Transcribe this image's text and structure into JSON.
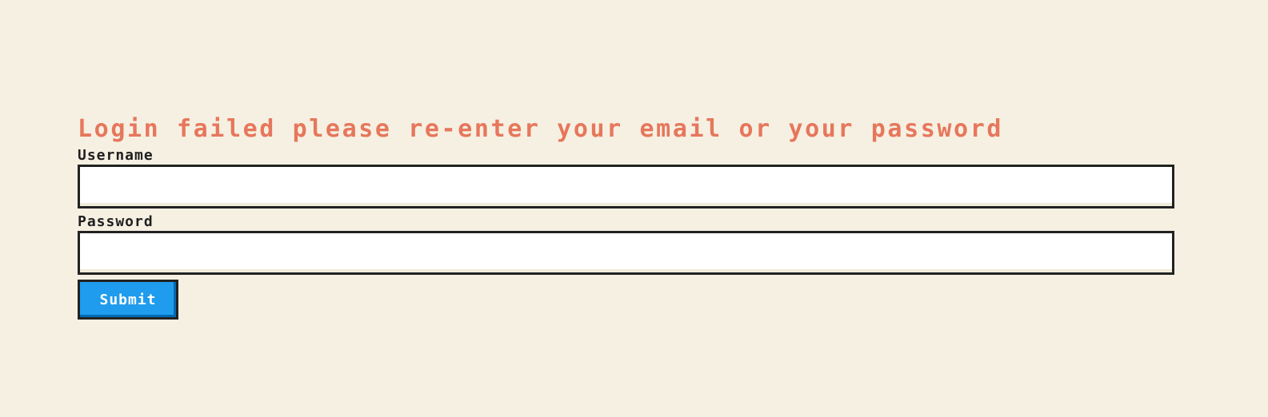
{
  "login": {
    "error_message": "Login failed please re-enter your email or your password",
    "username_label": "Username",
    "username_value": "",
    "password_label": "Password",
    "password_value": "",
    "submit_label": "Submit"
  },
  "colors": {
    "background": "#f6f0e2",
    "error_text": "#e6775c",
    "submit_button": "#209cee",
    "border": "#222222"
  }
}
